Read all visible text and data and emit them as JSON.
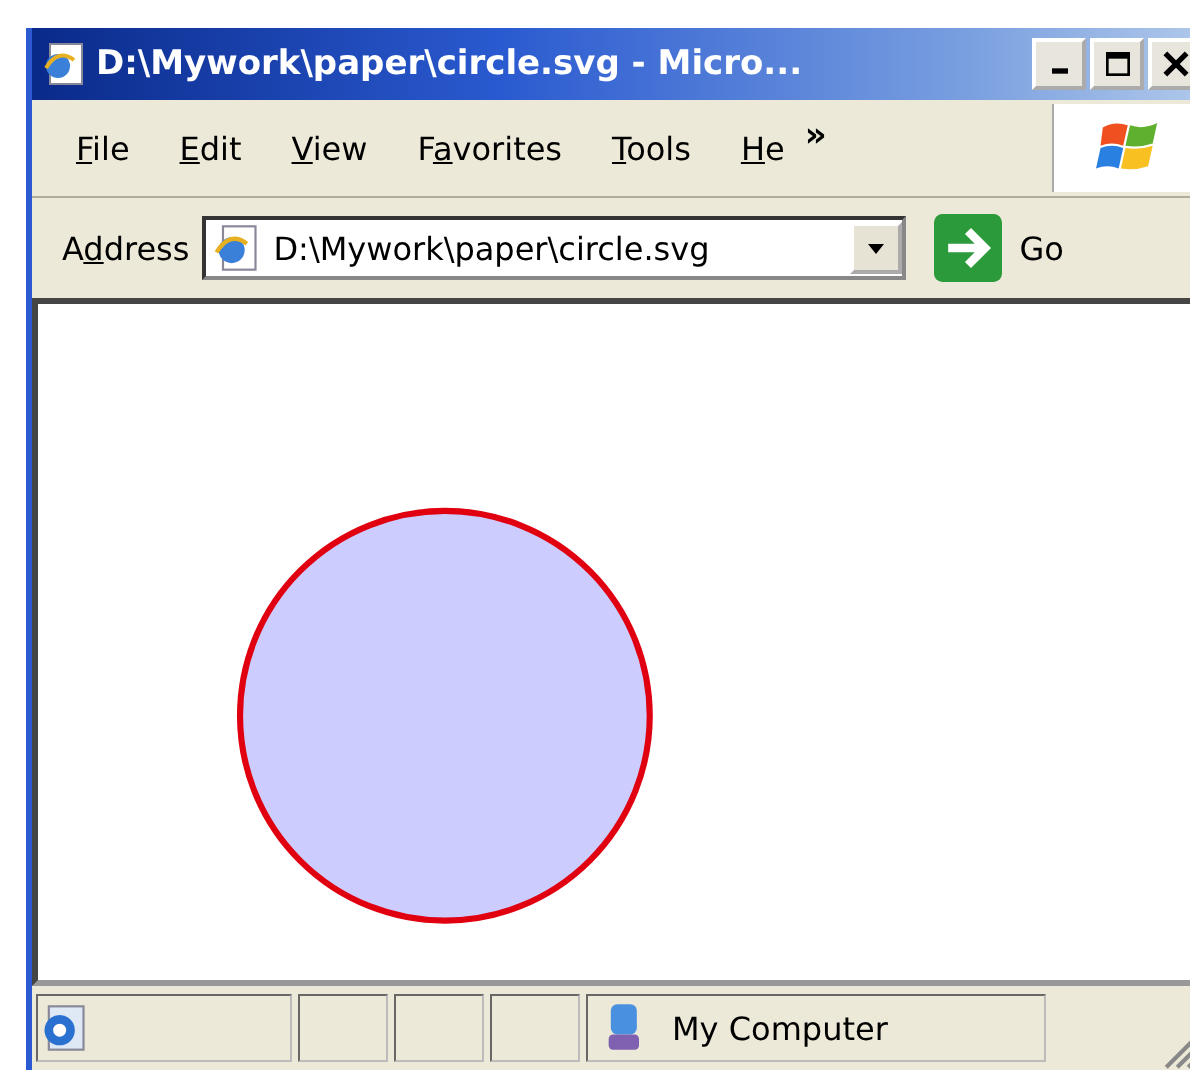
{
  "window": {
    "title": "D:\\Mywork\\paper\\circle.svg - Micro..."
  },
  "menu": [
    {
      "key": "F",
      "after": "ile"
    },
    {
      "key": "E",
      "after": "dit"
    },
    {
      "key": "V",
      "after": "iew"
    },
    {
      "before": "F",
      "key": "a",
      "after": "vorites"
    },
    {
      "key": "T",
      "after": "ools"
    },
    {
      "key": "H",
      "after": "e"
    }
  ],
  "menu_overflow": "»",
  "address_bar": {
    "label": {
      "before": "A",
      "key": "d",
      "after": "dress"
    },
    "value": "D:\\Mywork\\paper\\circle.svg",
    "go": "Go"
  },
  "status_bar": {
    "zone": "My Computer"
  }
}
